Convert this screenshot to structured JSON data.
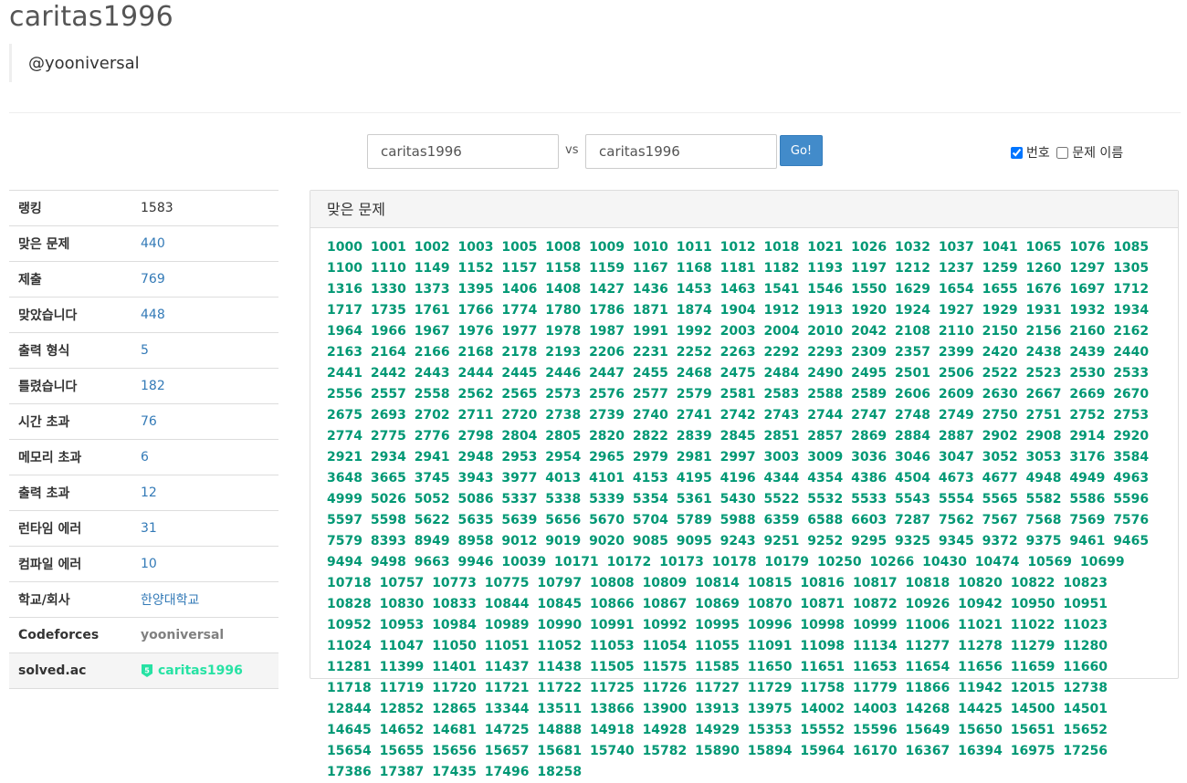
{
  "header": {
    "title": "caritas1996",
    "subtitle": "@yooniversal"
  },
  "vs_form": {
    "user1": "caritas1996",
    "vs_label": "vs",
    "user2": "caritas1996",
    "go_label": "Go!"
  },
  "options": {
    "number_label": "번호",
    "number_checked": true,
    "title_label": "문제 이름",
    "title_checked": false
  },
  "info": [
    {
      "key": "랭킹",
      "value": "1583",
      "style": "plain"
    },
    {
      "key": "맞은 문제",
      "value": "440",
      "style": "link"
    },
    {
      "key": "제출",
      "value": "769",
      "style": "link"
    },
    {
      "key": "맞았습니다",
      "value": "448",
      "style": "link"
    },
    {
      "key": "출력 형식",
      "value": "5",
      "style": "link"
    },
    {
      "key": "틀렸습니다",
      "value": "182",
      "style": "link"
    },
    {
      "key": "시간 초과",
      "value": "76",
      "style": "link"
    },
    {
      "key": "메모리 초과",
      "value": "6",
      "style": "link"
    },
    {
      "key": "출력 초과",
      "value": "12",
      "style": "link"
    },
    {
      "key": "런타임 에러",
      "value": "31",
      "style": "link"
    },
    {
      "key": "컴파일 에러",
      "value": "10",
      "style": "link"
    },
    {
      "key": "학교/회사",
      "value": "한양대학교",
      "style": "link"
    },
    {
      "key": "Codeforces",
      "value": "yooniversal",
      "style": "cf"
    },
    {
      "key": "solved.ac",
      "value": "caritas1996",
      "style": "solved",
      "tier_icon": "solvedac-tier-icon",
      "tier_label": "5"
    }
  ],
  "solved_panel": {
    "heading": "맞은 문제",
    "problems": [
      "1000",
      "1001",
      "1002",
      "1003",
      "1005",
      "1008",
      "1009",
      "1010",
      "1011",
      "1012",
      "1018",
      "1021",
      "1026",
      "1032",
      "1037",
      "1041",
      "1065",
      "1076",
      "1085",
      "1100",
      "1110",
      "1149",
      "1152",
      "1157",
      "1158",
      "1159",
      "1167",
      "1168",
      "1181",
      "1182",
      "1193",
      "1197",
      "1212",
      "1237",
      "1259",
      "1260",
      "1297",
      "1305",
      "1316",
      "1330",
      "1373",
      "1395",
      "1406",
      "1408",
      "1427",
      "1436",
      "1453",
      "1463",
      "1541",
      "1546",
      "1550",
      "1629",
      "1654",
      "1655",
      "1676",
      "1697",
      "1712",
      "1717",
      "1735",
      "1761",
      "1766",
      "1774",
      "1780",
      "1786",
      "1871",
      "1874",
      "1904",
      "1912",
      "1913",
      "1920",
      "1924",
      "1927",
      "1929",
      "1931",
      "1932",
      "1934",
      "1964",
      "1966",
      "1967",
      "1976",
      "1977",
      "1978",
      "1987",
      "1991",
      "1992",
      "2003",
      "2004",
      "2010",
      "2042",
      "2108",
      "2110",
      "2150",
      "2156",
      "2160",
      "2162",
      "2163",
      "2164",
      "2166",
      "2168",
      "2178",
      "2193",
      "2206",
      "2231",
      "2252",
      "2263",
      "2292",
      "2293",
      "2309",
      "2357",
      "2399",
      "2420",
      "2438",
      "2439",
      "2440",
      "2441",
      "2442",
      "2443",
      "2444",
      "2445",
      "2446",
      "2447",
      "2455",
      "2468",
      "2475",
      "2484",
      "2490",
      "2495",
      "2501",
      "2506",
      "2522",
      "2523",
      "2530",
      "2533",
      "2556",
      "2557",
      "2558",
      "2562",
      "2565",
      "2573",
      "2576",
      "2577",
      "2579",
      "2581",
      "2583",
      "2588",
      "2589",
      "2606",
      "2609",
      "2630",
      "2667",
      "2669",
      "2670",
      "2675",
      "2693",
      "2702",
      "2711",
      "2720",
      "2738",
      "2739",
      "2740",
      "2741",
      "2742",
      "2743",
      "2744",
      "2747",
      "2748",
      "2749",
      "2750",
      "2751",
      "2752",
      "2753",
      "2774",
      "2775",
      "2776",
      "2798",
      "2804",
      "2805",
      "2820",
      "2822",
      "2839",
      "2845",
      "2851",
      "2857",
      "2869",
      "2884",
      "2887",
      "2902",
      "2908",
      "2914",
      "2920",
      "2921",
      "2934",
      "2941",
      "2948",
      "2953",
      "2954",
      "2965",
      "2979",
      "2981",
      "2997",
      "3003",
      "3009",
      "3036",
      "3046",
      "3047",
      "3052",
      "3053",
      "3176",
      "3584",
      "3648",
      "3665",
      "3745",
      "3943",
      "3977",
      "4013",
      "4101",
      "4153",
      "4195",
      "4196",
      "4344",
      "4354",
      "4386",
      "4504",
      "4673",
      "4677",
      "4948",
      "4949",
      "4963",
      "4999",
      "5026",
      "5052",
      "5086",
      "5337",
      "5338",
      "5339",
      "5354",
      "5361",
      "5430",
      "5522",
      "5532",
      "5533",
      "5543",
      "5554",
      "5565",
      "5582",
      "5586",
      "5596",
      "5597",
      "5598",
      "5622",
      "5635",
      "5639",
      "5656",
      "5670",
      "5704",
      "5789",
      "5988",
      "6359",
      "6588",
      "6603",
      "7287",
      "7562",
      "7567",
      "7568",
      "7569",
      "7576",
      "7579",
      "8393",
      "8949",
      "8958",
      "9012",
      "9019",
      "9020",
      "9085",
      "9095",
      "9243",
      "9251",
      "9252",
      "9295",
      "9325",
      "9345",
      "9372",
      "9375",
      "9461",
      "9465",
      "9494",
      "9498",
      "9663",
      "9946",
      "10039",
      "10171",
      "10172",
      "10173",
      "10178",
      "10179",
      "10250",
      "10266",
      "10430",
      "10474",
      "10569",
      "10699",
      "10718",
      "10757",
      "10773",
      "10775",
      "10797",
      "10808",
      "10809",
      "10814",
      "10815",
      "10816",
      "10817",
      "10818",
      "10820",
      "10822",
      "10823",
      "10828",
      "10830",
      "10833",
      "10844",
      "10845",
      "10866",
      "10867",
      "10869",
      "10870",
      "10871",
      "10872",
      "10926",
      "10942",
      "10950",
      "10951",
      "10952",
      "10953",
      "10984",
      "10989",
      "10990",
      "10991",
      "10992",
      "10995",
      "10996",
      "10998",
      "10999",
      "11006",
      "11021",
      "11022",
      "11023",
      "11024",
      "11047",
      "11050",
      "11051",
      "11052",
      "11053",
      "11054",
      "11055",
      "11091",
      "11098",
      "11134",
      "11277",
      "11278",
      "11279",
      "11280",
      "11281",
      "11399",
      "11401",
      "11437",
      "11438",
      "11505",
      "11575",
      "11585",
      "11650",
      "11651",
      "11653",
      "11654",
      "11656",
      "11659",
      "11660",
      "11718",
      "11719",
      "11720",
      "11721",
      "11722",
      "11725",
      "11726",
      "11727",
      "11729",
      "11758",
      "11779",
      "11866",
      "11942",
      "12015",
      "12738",
      "12844",
      "12852",
      "12865",
      "13344",
      "13511",
      "13866",
      "13900",
      "13913",
      "13975",
      "14002",
      "14003",
      "14268",
      "14425",
      "14500",
      "14501",
      "14645",
      "14652",
      "14681",
      "14725",
      "14888",
      "14918",
      "14928",
      "14929",
      "15353",
      "15552",
      "15596",
      "15649",
      "15650",
      "15651",
      "15652",
      "15654",
      "15655",
      "15656",
      "15657",
      "15681",
      "15740",
      "15782",
      "15890",
      "15894",
      "15964",
      "16170",
      "16367",
      "16394",
      "16975",
      "17256",
      "17386",
      "17387",
      "17435",
      "17496",
      "18258"
    ]
  },
  "colors": {
    "link": "#337ab7",
    "solved_problem": "#009874",
    "solvedac_handle": "#27e2a4",
    "go_button": "#428bca"
  }
}
